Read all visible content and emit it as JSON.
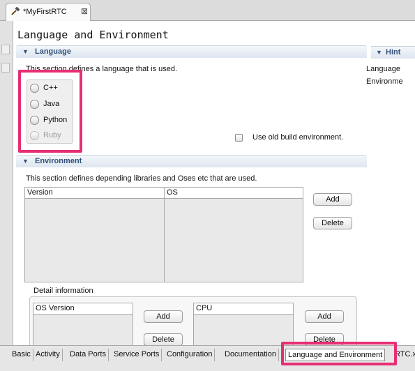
{
  "editor_tab": {
    "title": "*MyFirstRTC",
    "icon": "hammer-icon",
    "close_glyph": "⊠"
  },
  "page": {
    "title": "Language and Environment"
  },
  "language_section": {
    "title": "Language",
    "description": "This section defines a language that is used.",
    "options": [
      {
        "label": "C++",
        "enabled": true
      },
      {
        "label": "Java",
        "enabled": true
      },
      {
        "label": "Python",
        "enabled": true
      },
      {
        "label": "Ruby",
        "enabled": false
      }
    ],
    "old_build_label": "Use old build environment."
  },
  "environment_section": {
    "title": "Environment",
    "description": "This section defines depending libraries and Oses etc that are used.",
    "table_headers": [
      "Version",
      "OS"
    ],
    "add_label": "Add",
    "delete_label": "Delete"
  },
  "detail": {
    "label": "Detail information",
    "os_version_header": "OS Version",
    "cpu_header": "CPU",
    "add_label": "Add",
    "delete_label": "Delete"
  },
  "hint": {
    "title": "Hint",
    "lines": [
      "Language",
      "Environme"
    ]
  },
  "bottom_tabs": [
    {
      "label": "Basic",
      "active": false
    },
    {
      "label": "Activity",
      "active": false
    },
    {
      "label": "Data Ports",
      "active": false
    },
    {
      "label": "Service Ports",
      "active": false
    },
    {
      "label": "Configuration",
      "active": false
    },
    {
      "label": "Documentation",
      "active": false
    },
    {
      "label": "Language and Environment",
      "active": true
    },
    {
      "label": "RTC.x",
      "active": false
    }
  ],
  "colors": {
    "highlight": "#e62e74",
    "section_title": "#33517a"
  }
}
